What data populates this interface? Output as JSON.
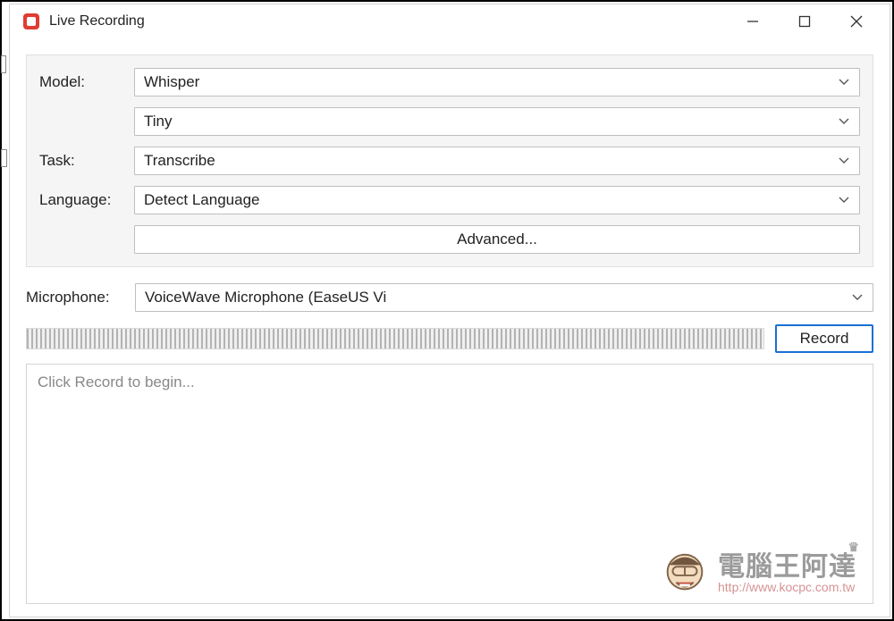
{
  "window": {
    "title": "Live Recording"
  },
  "form": {
    "model_label": "Model:",
    "model_value": "Whisper",
    "model_variant_value": "Tiny",
    "task_label": "Task:",
    "task_value": "Transcribe",
    "language_label": "Language:",
    "language_value": "Detect Language",
    "advanced_label": "Advanced..."
  },
  "microphone": {
    "label": "Microphone:",
    "value": "VoiceWave Microphone (EaseUS Vi"
  },
  "controls": {
    "record_label": "Record"
  },
  "output": {
    "placeholder": "Click Record to begin..."
  },
  "watermark": {
    "text": "電腦王阿達",
    "url": "http://www.kocpc.com.tw"
  }
}
